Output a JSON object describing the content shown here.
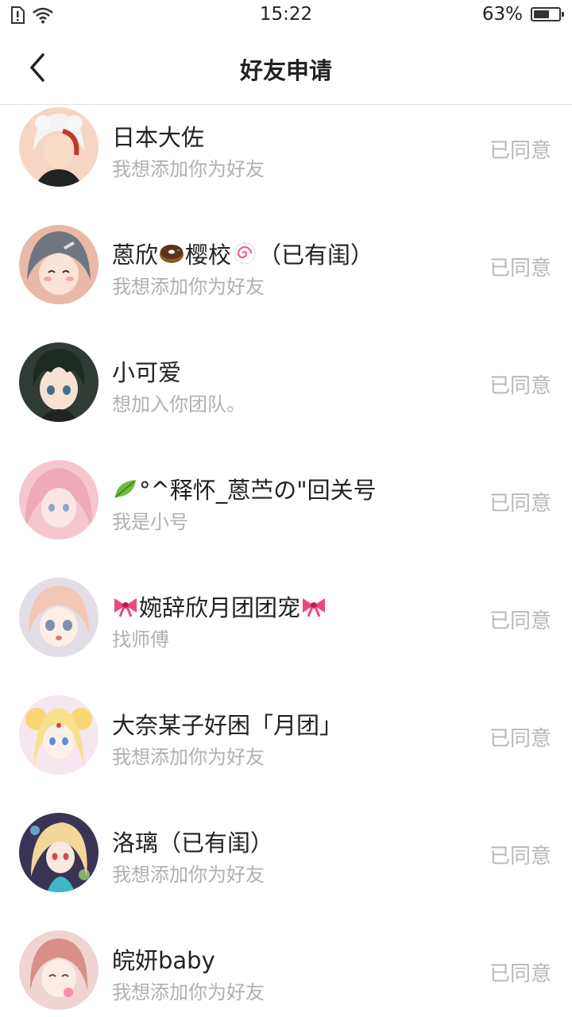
{
  "status_bar": {
    "time": "15:22",
    "battery_percent": "63%",
    "battery_level": 0.63
  },
  "header": {
    "title": "好友申请",
    "back_icon": "chevron-left-icon"
  },
  "requests": [
    {
      "name": "日本大佐",
      "message": "我想添加你为好友",
      "status": "已同意",
      "avatar_bg": "#f6d5c2"
    },
    {
      "name_parts": [
        "蒽欣",
        "🍩",
        "樱校",
        "🍥",
        "（已有闺）"
      ],
      "message": "我想添加你为好友",
      "status": "已同意",
      "avatar_bg": "#e8b9a6"
    },
    {
      "name": "小可爱",
      "message": "想加入你团队。",
      "status": "已同意",
      "avatar_bg": "#2f3b34"
    },
    {
      "name_parts": [
        "🍃",
        "°^释怀_蒽苎の\"回关号"
      ],
      "message": "我是小号",
      "status": "已同意",
      "avatar_bg": "#f4c7cf"
    },
    {
      "name_parts": [
        "🎀",
        "婉辞欣月团团宠",
        "🎀"
      ],
      "message": "找师傅",
      "status": "已同意",
      "avatar_bg": "#e3dde6"
    },
    {
      "name": "大奈某子好困「月团」",
      "message": "我想添加你为好友",
      "status": "已同意",
      "avatar_bg": "#f6e6f0"
    },
    {
      "name": "洛璃（已有闺）",
      "message": "我想添加你为好友",
      "status": "已同意",
      "avatar_bg": "#3a3454"
    },
    {
      "name": "皖妍baby",
      "message": "我想添加你为好友",
      "status": "已同意",
      "avatar_bg": "#f0d4d2"
    }
  ]
}
